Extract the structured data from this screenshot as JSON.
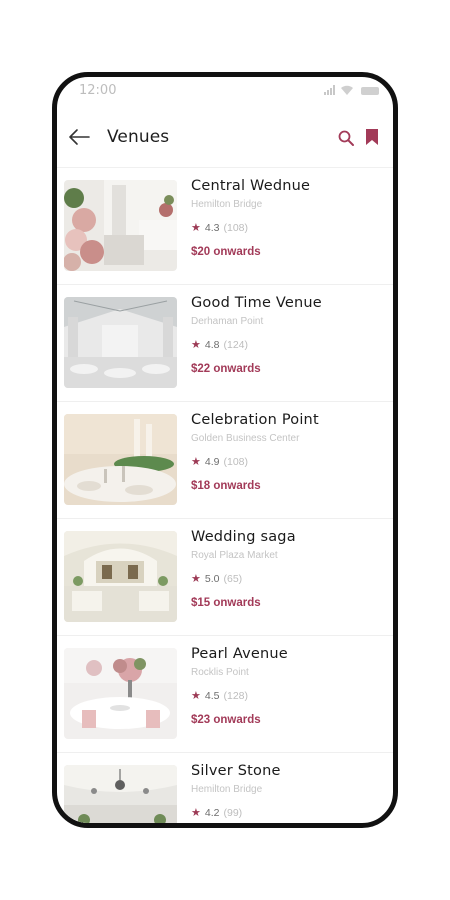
{
  "status_bar": {
    "time": "12:00"
  },
  "header": {
    "title": "Venues",
    "back_icon": "arrow-left-icon",
    "search_icon": "search-icon",
    "bookmark_icon": "bookmark-icon"
  },
  "colors": {
    "accent": "#a23a58",
    "star": "#9c3a55"
  },
  "venues": [
    {
      "name": "Central Wednue",
      "location": "Hemilton Bridge",
      "rating": "4.3",
      "reviews": "(108)",
      "price": "$20 onwards"
    },
    {
      "name": "Good Time Venue",
      "location": "Derhaman Point",
      "rating": "4.8",
      "reviews": "(124)",
      "price": "$22 onwards"
    },
    {
      "name": "Celebration Point",
      "location": "Golden Business Center",
      "rating": "4.9",
      "reviews": "(108)",
      "price": "$18 onwards"
    },
    {
      "name": "Wedding saga",
      "location": "Royal Plaza Market",
      "rating": "5.0",
      "reviews": "(65)",
      "price": "$15 onwards"
    },
    {
      "name": "Pearl Avenue",
      "location": "Rocklis Point",
      "rating": "4.5",
      "reviews": "(128)",
      "price": "$23 onwards"
    },
    {
      "name": "Silver Stone",
      "location": "Hemilton Bridge",
      "rating": "4.2",
      "reviews": "(99)",
      "price": ""
    }
  ]
}
